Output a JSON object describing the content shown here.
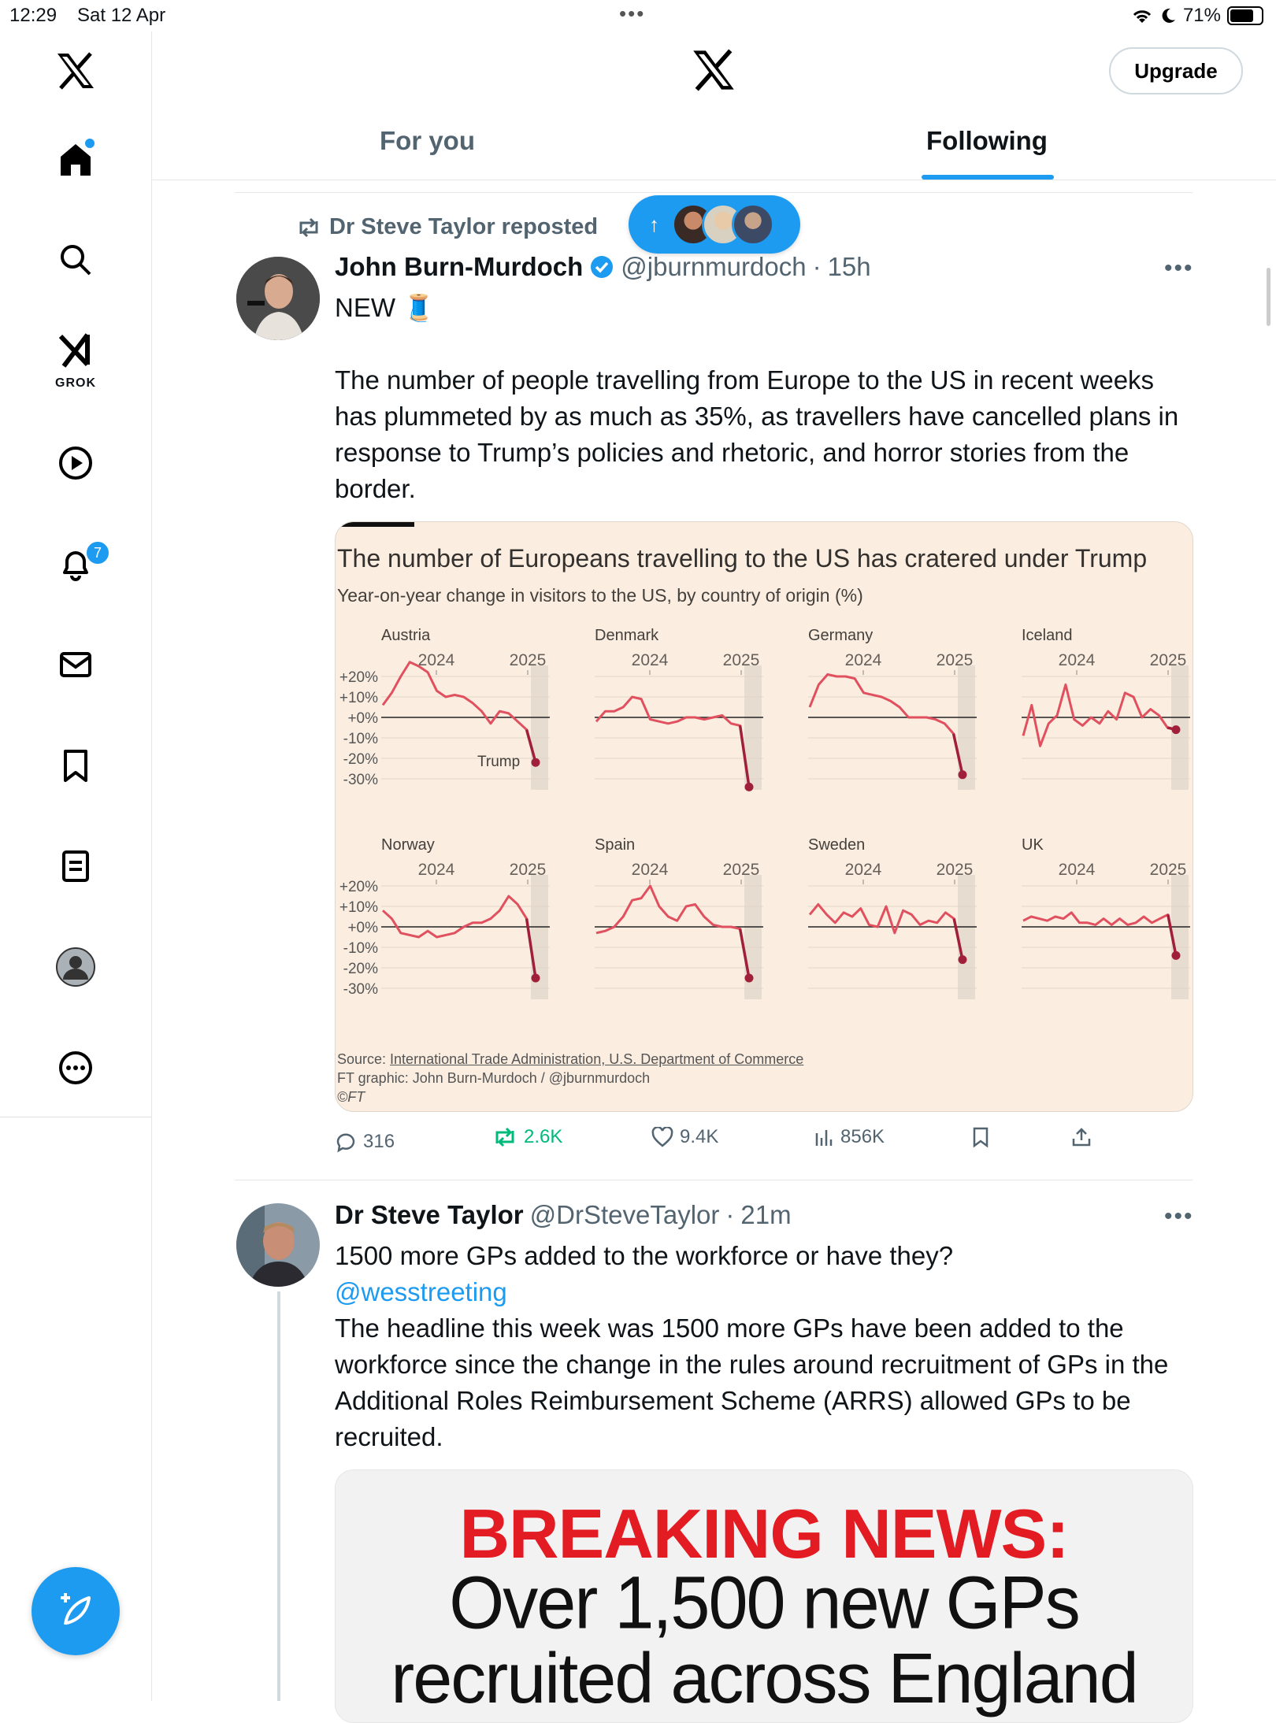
{
  "status_bar": {
    "time": "12:29",
    "date": "Sat 12 Apr",
    "battery": "71%"
  },
  "header": {
    "upgrade_label": "Upgrade",
    "tabs": [
      "For you",
      "Following"
    ],
    "active_tab": "Following"
  },
  "sidebar": {
    "items": [
      "home-icon",
      "search-icon",
      "grok-icon",
      "video-icon",
      "notifications-icon",
      "messages-icon",
      "bookmarks-icon",
      "lists-icon",
      "profile-icon",
      "more-icon"
    ],
    "grok_label": "GROK",
    "notifications_badge": "7"
  },
  "tweet1": {
    "repost_text": "Dr Steve Taylor reposted",
    "name": "John Burn-Murdoch",
    "handle": "@jburnmurdoch",
    "time": "15h",
    "line1": "NEW 🧵",
    "body": "The number of people travelling from Europe to the US in recent weeks has plummeted by as much as 35%, as travellers have cancelled plans in response to Trump’s policies and rhetoric, and horror stories from the border.",
    "stats": {
      "replies": "316",
      "reposts": "2.6K",
      "likes": "9.4K",
      "views": "856K"
    }
  },
  "chart": {
    "title": "The number of Europeans travelling to the US has cratered under Trump",
    "subtitle": "Year-on-year change in visitors to the US, by country of origin (%)",
    "source_prefix": "Source: ",
    "source_link": "International Trade Administration, U.S. Department of Commerce",
    "credit": "FT graphic: John Burn-Murdoch / @jburnmurdoch",
    "copyright": "©FT",
    "annotation": "Trump"
  },
  "chart_data": {
    "type": "line",
    "title": "The number of Europeans travelling to the US has cratered under Trump",
    "subtitle": "Year-on-year change in visitors to the US, by country of origin (%)",
    "x_ticks": [
      "2024",
      "2025"
    ],
    "y_ticks": [
      "+20%",
      "+10%",
      "+0%",
      "-10%",
      "-20%",
      "-30%"
    ],
    "ylim": [
      -30,
      20
    ],
    "series": [
      {
        "name": "Austria",
        "values": [
          6,
          12,
          20,
          27,
          25,
          22,
          13,
          10,
          11,
          10,
          7,
          3,
          -3,
          3,
          2,
          -2,
          -6,
          -22
        ]
      },
      {
        "name": "Denmark",
        "values": [
          -2,
          3,
          3,
          5,
          10,
          9,
          -1,
          -2,
          -3,
          -2,
          0,
          0,
          -1,
          0,
          1,
          -3,
          -4,
          -34
        ]
      },
      {
        "name": "Germany",
        "values": [
          5,
          16,
          21,
          20,
          20,
          19,
          12,
          11,
          10,
          8,
          5,
          0,
          0,
          0,
          -1,
          -3,
          -8,
          -28
        ]
      },
      {
        "name": "Iceland",
        "values": [
          -9,
          6,
          -14,
          -3,
          1,
          16,
          -1,
          -4,
          0,
          -3,
          3,
          -1,
          12,
          10,
          0,
          4,
          1,
          -5,
          -6
        ]
      },
      {
        "name": "Norway",
        "values": [
          8,
          4,
          -3,
          -4,
          -5,
          -2,
          -5,
          -4,
          -3,
          0,
          2,
          2,
          4,
          8,
          15,
          11,
          4,
          -25
        ]
      },
      {
        "name": "Spain",
        "values": [
          -3,
          -2,
          0,
          5,
          13,
          14,
          20,
          10,
          5,
          3,
          10,
          11,
          5,
          1,
          0,
          0,
          -1,
          -25
        ]
      },
      {
        "name": "Sweden",
        "values": [
          6,
          11,
          6,
          2,
          7,
          5,
          9,
          1,
          0,
          10,
          -3,
          8,
          6,
          1,
          3,
          2,
          7,
          4,
          -16
        ]
      },
      {
        "name": "UK",
        "values": [
          3,
          5,
          4,
          3,
          5,
          4,
          7,
          2,
          2,
          1,
          4,
          1,
          4,
          1,
          2,
          5,
          2,
          4,
          6,
          -14
        ]
      }
    ]
  },
  "tweet2": {
    "name": "Dr Steve Taylor",
    "handle": "@DrSteveTaylor",
    "time": "21m",
    "line1": "1500 more GPs added to the workforce or have they?",
    "mention": "@wesstreeting",
    "body": "The headline this week was 1500 more GPs have been added to the workforce since the change in the rules around recruitment of GPs in the Additional Roles Reimbursement Scheme (ARRS) allowed GPs to be recruited.",
    "image_text": {
      "line1": "BREAKING NEWS:",
      "line2": "Over 1,500 new GPs",
      "line3": "recruited across England"
    }
  },
  "colors": {
    "accent": "#1d9bf0",
    "repost_green": "#00ba7c",
    "chart_line": "#e0505e",
    "chart_bg": "#fbeee1",
    "breaking_red": "#e31b23"
  }
}
